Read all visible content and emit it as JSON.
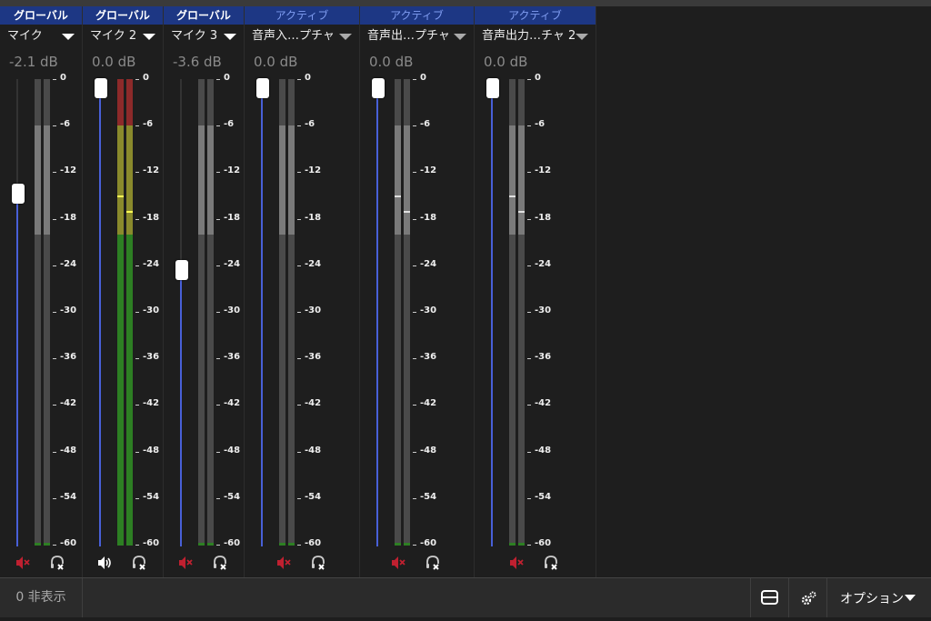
{
  "channels": [
    {
      "header": "グローバル",
      "header_type": "global",
      "source": "マイク",
      "db": "-2.1 dB",
      "volume_db": -2.1,
      "meter_peak_db": null,
      "muted": true,
      "monitor": "off"
    },
    {
      "header": "グローバル",
      "header_type": "global",
      "source": "マイク 2",
      "db": "0.0 dB",
      "volume_db": 0.0,
      "meter_peak_db": -17.0,
      "muted": false,
      "monitor": "off"
    },
    {
      "header": "グローバル",
      "header_type": "global",
      "source": "マイク 3",
      "db": "-3.6 dB",
      "volume_db": -3.6,
      "meter_peak_db": null,
      "muted": true,
      "monitor": "off"
    },
    {
      "header": "アクティブ",
      "header_type": "active",
      "source": "音声入…プチャ",
      "db": "0.0 dB",
      "volume_db": 0.0,
      "meter_peak_db": null,
      "muted": true,
      "monitor": "off"
    },
    {
      "header": "アクティブ",
      "header_type": "active",
      "source": "音声出…プチャ",
      "db": "0.0 dB",
      "volume_db": 0.0,
      "meter_peak_db": -17.0,
      "muted": true,
      "monitor": "off"
    },
    {
      "header": "アクティブ",
      "header_type": "active",
      "source": "音声出力…チャ 2",
      "db": "0.0 dB",
      "volume_db": 0.0,
      "meter_peak_db": -17.0,
      "muted": true,
      "monitor": "off"
    }
  ],
  "scale_labels": [
    "0",
    "-6",
    "-12",
    "-18",
    "-24",
    "-30",
    "-36",
    "-42",
    "-48",
    "-54",
    "-60"
  ],
  "colors": {
    "header_bg": "#1d3784",
    "header_global_text": "#ffffff",
    "header_active_text": "#7f9cf0",
    "fader_fill": "#4860d8",
    "meter_red": "#8d2a2a",
    "meter_yellow": "#8a8a2c",
    "meter_green": "#2d7f23",
    "meter_inactive_light": "#7a7a7a",
    "meter_inactive_dark": "#4a4a4a",
    "mute_icon": "#c02030"
  },
  "bottom": {
    "hidden_count": "0 非表示",
    "layout_icon": "layout-toggle-icon",
    "settings_icon": "gear-icon",
    "options_label": "オプション"
  }
}
